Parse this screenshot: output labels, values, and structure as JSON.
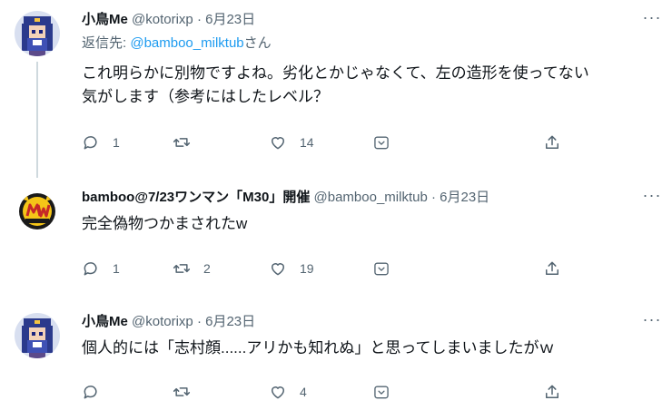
{
  "tweets": [
    {
      "name": "小鳥Me",
      "handle": "@kotorixp",
      "dot": "·",
      "date": "6月23日",
      "reply_prefix": "返信先: ",
      "reply_to": "@bamboo_milktub",
      "reply_suffix": "さん",
      "text_line1": "これ明らかに別物ですよね。劣化とかじゃなくて、左の造形を使ってない",
      "text_line2": "気がします（参考にはしたレベル？",
      "replies": "1",
      "retweets": "",
      "likes": "14",
      "avatar": "pixel-art-character"
    },
    {
      "name": "bamboo@7/23ワンマン「M30」開催",
      "handle": "@bamboo_milktub",
      "dot": "·",
      "date": "6月23日",
      "text_line1": "完全偽物つかまされたw",
      "replies": "1",
      "retweets": "2",
      "likes": "19",
      "avatar": "mw-logo"
    },
    {
      "name": "小鳥Me",
      "handle": "@kotorixp",
      "dot": "·",
      "date": "6月23日",
      "text_line1": "個人的には「志村顔......アリかも知れぬ」と思ってしまいましたがｗ",
      "replies": "",
      "retweets": "",
      "likes": "4",
      "avatar": "pixel-art-character"
    }
  ],
  "more_label": "···",
  "colors": {
    "accent": "#1d9bf0",
    "muted": "#536471",
    "line": "#cfd9de"
  }
}
